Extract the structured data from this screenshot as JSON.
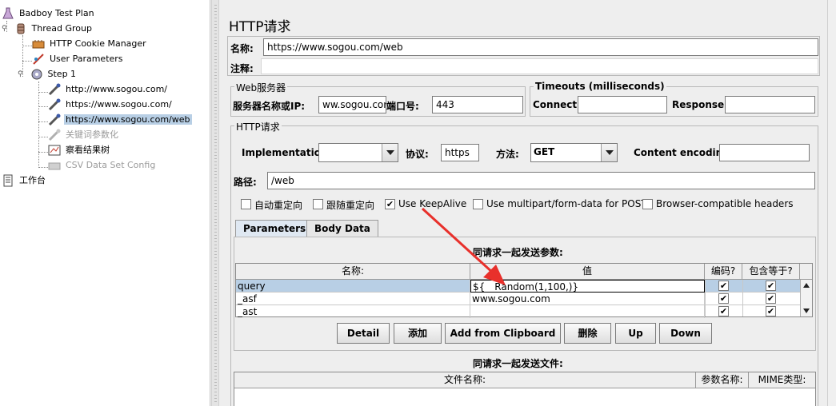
{
  "tree": {
    "items": [
      {
        "label": "Badboy Test Plan",
        "icon": "test-plan-icon"
      },
      {
        "label": "Thread Group",
        "icon": "thread-group-icon"
      },
      {
        "label": "HTTP Cookie Manager",
        "icon": "cookie-manager-icon"
      },
      {
        "label": "User Parameters",
        "icon": "user-parameters-icon"
      },
      {
        "label": "Step 1",
        "icon": "step-gear-icon"
      },
      {
        "label": "http://www.sogou.com/",
        "icon": "sampler-pipette-icon"
      },
      {
        "label": "https://www.sogou.com/",
        "icon": "sampler-pipette-icon"
      },
      {
        "label": "https://www.sogou.com/web",
        "icon": "sampler-pipette-icon"
      },
      {
        "label": "关键词参数化",
        "icon": "disabled-sampler-icon"
      },
      {
        "label": "察看结果树",
        "icon": "results-tree-icon"
      },
      {
        "label": "CSV Data Set Config",
        "icon": "csv-config-icon"
      },
      {
        "label": "工作台",
        "icon": "workbench-icon"
      }
    ]
  },
  "panel": {
    "title": "HTTP请求",
    "name_label": "名称:",
    "name_value": "https://www.sogou.com/web",
    "comment_label": "注释:",
    "comment_value": ""
  },
  "web_server": {
    "legend": "Web服务器",
    "server_label": "服务器名称或IP:",
    "server_value": "ww.sogou.com",
    "port_label": "端口号:",
    "port_value": "443"
  },
  "timeouts": {
    "legend": "Timeouts (milliseconds)",
    "connect_label": "Connect:",
    "connect_value": "",
    "response_label": "Response:",
    "response_value": ""
  },
  "http": {
    "legend": "HTTP请求",
    "impl_label": "Implementation:",
    "impl_value": "",
    "protocol_label": "协议:",
    "protocol_value": "https",
    "method_label": "方法:",
    "method_value": "GET",
    "encoding_label": "Content encoding:",
    "encoding_value": "",
    "path_label": "路径:",
    "path_value": "/web"
  },
  "options": [
    {
      "label": "自动重定向",
      "checked": false
    },
    {
      "label": "跟随重定向",
      "checked": false
    },
    {
      "label": "Use KeepAlive",
      "checked": true
    },
    {
      "label": "Use multipart/form-data for POST",
      "checked": false
    },
    {
      "label": "Browser-compatible headers",
      "checked": false
    }
  ],
  "tabs": [
    "Parameters",
    "Body Data"
  ],
  "params": {
    "title": "同请求一起发送参数:",
    "columns": [
      "名称:",
      "值",
      "编码?",
      "包含等于?"
    ],
    "rows": [
      {
        "name": "query",
        "value": "${__Random(1,100,)}",
        "encode": true,
        "include_equals": true
      },
      {
        "name": "_asf",
        "value": "www.sogou.com",
        "encode": true,
        "include_equals": true
      },
      {
        "name": "_ast",
        "value": "",
        "encode": true,
        "include_equals": true
      }
    ]
  },
  "buttons": [
    "Detail",
    "添加",
    "Add from Clipboard",
    "删除",
    "Up",
    "Down"
  ],
  "files": {
    "title": "同请求一起发送文件:",
    "columns": [
      "文件名称:",
      "参数名称:",
      "MIME类型:"
    ]
  },
  "annotation_color": "#e8302b"
}
